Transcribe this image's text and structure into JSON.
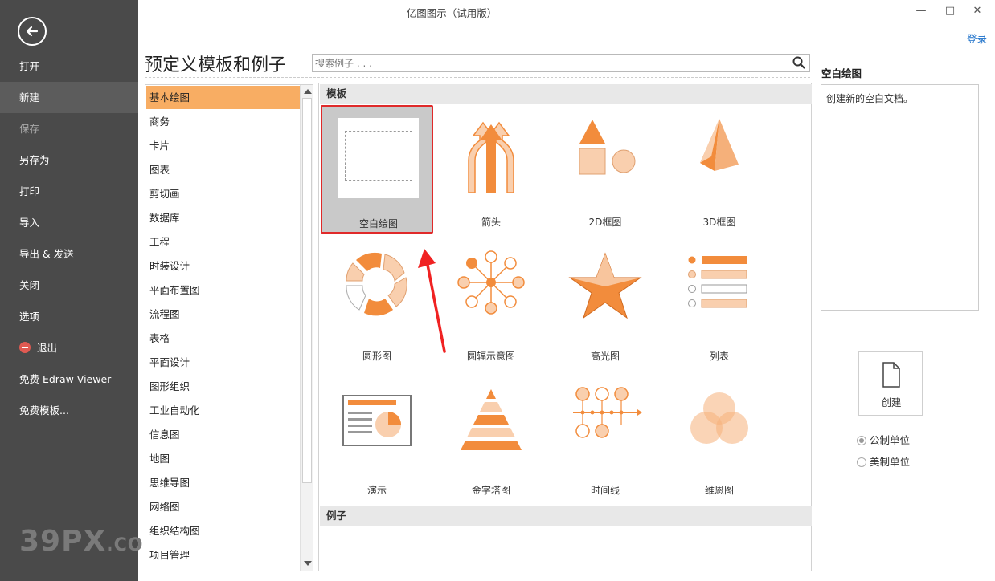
{
  "window": {
    "title": "亿图图示（试用版）",
    "login": "登录"
  },
  "sidebar": {
    "items": [
      {
        "label": "打开"
      },
      {
        "label": "新建"
      },
      {
        "label": "保存"
      },
      {
        "label": "另存为"
      },
      {
        "label": "打印"
      },
      {
        "label": "导入"
      },
      {
        "label": "导出 & 发送"
      },
      {
        "label": "关闭"
      },
      {
        "label": "选项"
      },
      {
        "label": "退出"
      },
      {
        "label": "免费 Edraw Viewer"
      },
      {
        "label": "免费模板..."
      }
    ],
    "active": "新建",
    "disabled": "保存"
  },
  "watermark": {
    "text": "39PX",
    "suffix": ".COM"
  },
  "heading": "预定义模板和例子",
  "search": {
    "placeholder": "搜索例子 . . .",
    "value": ""
  },
  "categories": [
    "基本绘图",
    "商务",
    "卡片",
    "图表",
    "剪切画",
    "数据库",
    "工程",
    "时装设计",
    "平面布置图",
    "流程图",
    "表格",
    "平面设计",
    "图形组织",
    "工业自动化",
    "信息图",
    "地图",
    "思维导图",
    "网络图",
    "组织结构图",
    "项目管理"
  ],
  "selected_category": "基本绘图",
  "sections": {
    "templates": "模板",
    "examples": "例子"
  },
  "templates": [
    {
      "label": "空白绘图",
      "icon": "blank-drawing-icon"
    },
    {
      "label": "箭头",
      "icon": "arrows-icon"
    },
    {
      "label": "2D框图",
      "icon": "2d-shapes-icon"
    },
    {
      "label": "3D框图",
      "icon": "3d-pyramid-icon"
    },
    {
      "label": "圆形图",
      "icon": "circle-chart-icon"
    },
    {
      "label": "圆辐示意图",
      "icon": "radial-diagram-icon"
    },
    {
      "label": "高光图",
      "icon": "highlight-star-icon"
    },
    {
      "label": "列表",
      "icon": "list-icon"
    },
    {
      "label": "演示",
      "icon": "presentation-icon"
    },
    {
      "label": "金字塔图",
      "icon": "pyramid-icon"
    },
    {
      "label": "时间线",
      "icon": "timeline-icon"
    },
    {
      "label": "维恩图",
      "icon": "venn-icon"
    }
  ],
  "selected_template": "空白绘图",
  "details": {
    "title": "空白绘图",
    "description": "创建新的空白文档。",
    "create_label": "创建"
  },
  "units": [
    {
      "label": "公制单位",
      "checked": true
    },
    {
      "label": "美制单位",
      "checked": false
    }
  ],
  "colors": {
    "accent": "#f8ad63",
    "icon_orange": "#f28c3c",
    "icon_light": "#f9cfae",
    "sidebar_bg": "#4a4a4a",
    "selection_border": "#e02a2a",
    "link": "#1a6fc9"
  }
}
